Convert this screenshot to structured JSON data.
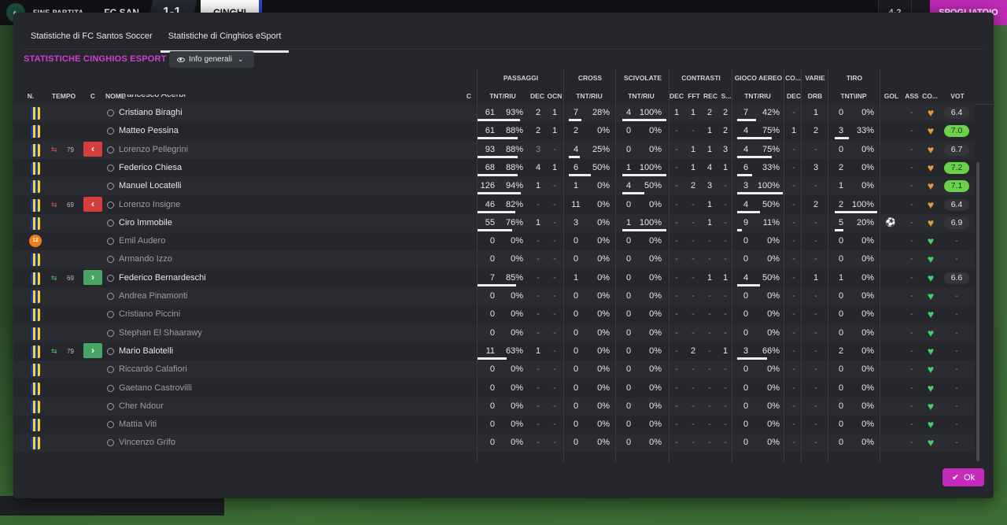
{
  "topbar": {
    "status": "FINE PARTITA",
    "home": "FC SAN",
    "score": "1-1",
    "away": "CINGHI",
    "count": "4-2",
    "action": "SPOGLIATOIO"
  },
  "tabs": [
    {
      "label": "Statistiche di FC Santos Soccer",
      "active": false
    },
    {
      "label": "Statistiche di Cinghios eSport",
      "active": true
    }
  ],
  "section_title": "STATISTICHE CINGHIOS ESPORT",
  "view_select": "Info generali",
  "groups": {
    "passaggi": "PASSAGGI",
    "cross": "CROSS",
    "scivolate": "SCIVOLATE",
    "contrasti": "CONTRASTI",
    "gioco_aereo": "GIOCO AEREO",
    "co": "CO...",
    "varie": "VARIE",
    "tiro": "TIRO"
  },
  "headers": {
    "n": "N.",
    "tempo": "TEMPO",
    "c": "C",
    "nome": "NOME",
    "c2": "C",
    "pass_tnt": "TNT/RIU",
    "pass_dec": "DEC",
    "pass_ocn": "OCN",
    "cross_tnt": "TNT/RIU",
    "sciv_tnt": "TNT/RIU",
    "con_dec": "DEC",
    "con_fft": "FFT",
    "con_rec": "REC",
    "con_s": "S...",
    "aer_tnt": "TNT/RIU",
    "co_dec": "DEC",
    "var_drb": "DRB",
    "tiro_tnt": "TNT\\INP",
    "gol": "GOL",
    "ass": "ASS",
    "co2": "CO...",
    "vot": "VOT"
  },
  "partial_row_name": "Francesco Acerbi",
  "players": [
    {
      "name": "Cristiano Biraghi",
      "dim": false,
      "sub": null,
      "min": "",
      "pass_n": "61",
      "pass_p": "93%",
      "pass_frac": 0.93,
      "dec": "2",
      "ocn": "1",
      "cross_n": "7",
      "cross_p": "28%",
      "cross_frac": 0.28,
      "sciv_n": "4",
      "sciv_p": "100%",
      "sciv_frac": 1.0,
      "cdec": "1",
      "cfft": "1",
      "crec": "2",
      "cs": "2",
      "aer_n": "7",
      "aer_p": "42%",
      "aer_frac": 0.42,
      "codec": "-",
      "drb": "1",
      "tiro_n": "0",
      "tiro_p": "0%",
      "tiro_frac": 0,
      "gol": "",
      "ass": "-",
      "heart": "orange",
      "vot": "6.4",
      "vot_style": "avg"
    },
    {
      "name": "Matteo Pessina",
      "dim": false,
      "sub": null,
      "min": "",
      "pass_n": "61",
      "pass_p": "88%",
      "pass_frac": 0.88,
      "dec": "2",
      "ocn": "1",
      "cross_n": "2",
      "cross_p": "0%",
      "cross_frac": 0,
      "sciv_n": "0",
      "sciv_p": "0%",
      "sciv_frac": 0,
      "cdec": "-",
      "cfft": "-",
      "crec": "1",
      "cs": "2",
      "aer_n": "4",
      "aer_p": "75%",
      "aer_frac": 0.75,
      "codec": "1",
      "drb": "2",
      "tiro_n": "3",
      "tiro_p": "33%",
      "tiro_frac": 0.33,
      "gol": "",
      "ass": "-",
      "heart": "orange",
      "vot": "7.0",
      "vot_style": "good"
    },
    {
      "name": "Lorenzo Pellegrini",
      "dim": true,
      "sub": "out",
      "min": "79",
      "pass_n": "93",
      "pass_p": "88%",
      "pass_frac": 0.88,
      "dec": "3",
      "ocn": "-",
      "cross_n": "4",
      "cross_p": "25%",
      "cross_frac": 0.25,
      "sciv_n": "0",
      "sciv_p": "0%",
      "sciv_frac": 0,
      "cdec": "-",
      "cfft": "1",
      "crec": "1",
      "cs": "3",
      "aer_n": "4",
      "aer_p": "75%",
      "aer_frac": 0.75,
      "codec": "-",
      "drb": "-",
      "tiro_n": "0",
      "tiro_p": "0%",
      "tiro_frac": 0,
      "gol": "",
      "ass": "-",
      "heart": "orange",
      "vot": "6.7",
      "vot_style": "avg"
    },
    {
      "name": "Federico Chiesa",
      "dim": false,
      "sub": null,
      "min": "",
      "pass_n": "68",
      "pass_p": "88%",
      "pass_frac": 0.88,
      "dec": "4",
      "ocn": "1",
      "cross_n": "6",
      "cross_p": "50%",
      "cross_frac": 0.5,
      "sciv_n": "1",
      "sciv_p": "100%",
      "sciv_frac": 1.0,
      "cdec": "-",
      "cfft": "1",
      "crec": "4",
      "cs": "1",
      "aer_n": "6",
      "aer_p": "33%",
      "aer_frac": 0.33,
      "codec": "-",
      "drb": "3",
      "tiro_n": "2",
      "tiro_p": "0%",
      "tiro_frac": 0,
      "gol": "",
      "ass": "-",
      "heart": "orange",
      "vot": "7.2",
      "vot_style": "good"
    },
    {
      "name": "Manuel Locatelli",
      "dim": false,
      "sub": null,
      "min": "",
      "pass_n": "126",
      "pass_p": "94%",
      "pass_frac": 0.94,
      "dec": "1",
      "ocn": "-",
      "cross_n": "1",
      "cross_p": "0%",
      "cross_frac": 0,
      "sciv_n": "4",
      "sciv_p": "50%",
      "sciv_frac": 0.5,
      "cdec": "-",
      "cfft": "2",
      "crec": "3",
      "cs": "-",
      "aer_n": "3",
      "aer_p": "100%",
      "aer_frac": 1.0,
      "codec": "-",
      "drb": "-",
      "tiro_n": "1",
      "tiro_p": "0%",
      "tiro_frac": 0,
      "gol": "",
      "ass": "-",
      "heart": "orange",
      "vot": "7.1",
      "vot_style": "good"
    },
    {
      "name": "Lorenzo Insigne",
      "dim": true,
      "sub": "out",
      "min": "69",
      "pass_n": "46",
      "pass_p": "82%",
      "pass_frac": 0.82,
      "dec": "-",
      "ocn": "-",
      "cross_n": "11",
      "cross_p": "0%",
      "cross_frac": 0,
      "sciv_n": "0",
      "sciv_p": "0%",
      "sciv_frac": 0,
      "cdec": "-",
      "cfft": "-",
      "crec": "1",
      "cs": "-",
      "aer_n": "4",
      "aer_p": "50%",
      "aer_frac": 0.5,
      "codec": "-",
      "drb": "2",
      "tiro_n": "2",
      "tiro_p": "100%",
      "tiro_frac": 1.0,
      "gol": "",
      "ass": "-",
      "heart": "orange",
      "vot": "6.4",
      "vot_style": "avg"
    },
    {
      "name": "Ciro Immobile",
      "dim": false,
      "sub": null,
      "min": "",
      "pass_n": "55",
      "pass_p": "76%",
      "pass_frac": 0.76,
      "dec": "1",
      "ocn": "-",
      "cross_n": "3",
      "cross_p": "0%",
      "cross_frac": 0,
      "sciv_n": "1",
      "sciv_p": "100%",
      "sciv_frac": 1.0,
      "cdec": "-",
      "cfft": "-",
      "crec": "1",
      "cs": "-",
      "aer_n": "9",
      "aer_p": "11%",
      "aer_frac": 0.11,
      "codec": "-",
      "drb": "-",
      "tiro_n": "5",
      "tiro_p": "20%",
      "tiro_frac": 0.2,
      "gol": "gear",
      "ass": "-",
      "heart": "orange",
      "vot": "6.9",
      "vot_style": "avg"
    },
    {
      "name": "Emil Audero",
      "dim": true,
      "gk": true,
      "gk_num": "12",
      "sub": null,
      "min": "",
      "pass_n": "0",
      "pass_p": "0%",
      "pass_frac": 0,
      "dec": "-",
      "ocn": "-",
      "cross_n": "0",
      "cross_p": "0%",
      "cross_frac": 0,
      "sciv_n": "0",
      "sciv_p": "0%",
      "sciv_frac": 0,
      "cdec": "-",
      "cfft": "-",
      "crec": "-",
      "cs": "-",
      "aer_n": "0",
      "aer_p": "0%",
      "aer_frac": 0,
      "codec": "-",
      "drb": "-",
      "tiro_n": "0",
      "tiro_p": "0%",
      "tiro_frac": 0,
      "gol": "",
      "ass": "-",
      "heart": "green",
      "vot": "-",
      "vot_style": "none"
    },
    {
      "name": "Armando Izzo",
      "dim": true,
      "sub": null,
      "min": "",
      "pass_n": "0",
      "pass_p": "0%",
      "pass_frac": 0,
      "dec": "-",
      "ocn": "-",
      "cross_n": "0",
      "cross_p": "0%",
      "cross_frac": 0,
      "sciv_n": "0",
      "sciv_p": "0%",
      "sciv_frac": 0,
      "cdec": "-",
      "cfft": "-",
      "crec": "-",
      "cs": "-",
      "aer_n": "0",
      "aer_p": "0%",
      "aer_frac": 0,
      "codec": "-",
      "drb": "-",
      "tiro_n": "0",
      "tiro_p": "0%",
      "tiro_frac": 0,
      "gol": "",
      "ass": "-",
      "heart": "green",
      "vot": "-",
      "vot_style": "none"
    },
    {
      "name": "Federico Bernardeschi",
      "dim": false,
      "sub": "in",
      "min": "69",
      "pass_n": "7",
      "pass_p": "85%",
      "pass_frac": 0.85,
      "dec": "-",
      "ocn": "-",
      "cross_n": "1",
      "cross_p": "0%",
      "cross_frac": 0,
      "sciv_n": "0",
      "sciv_p": "0%",
      "sciv_frac": 0,
      "cdec": "-",
      "cfft": "-",
      "crec": "1",
      "cs": "1",
      "aer_n": "4",
      "aer_p": "50%",
      "aer_frac": 0.5,
      "codec": "-",
      "drb": "1",
      "tiro_n": "1",
      "tiro_p": "0%",
      "tiro_frac": 0,
      "gol": "",
      "ass": "-",
      "heart": "green",
      "vot": "6.6",
      "vot_style": "avg"
    },
    {
      "name": "Andrea Pinamonti",
      "dim": true,
      "sub": null,
      "min": "",
      "pass_n": "0",
      "pass_p": "0%",
      "pass_frac": 0,
      "dec": "-",
      "ocn": "-",
      "cross_n": "0",
      "cross_p": "0%",
      "cross_frac": 0,
      "sciv_n": "0",
      "sciv_p": "0%",
      "sciv_frac": 0,
      "cdec": "-",
      "cfft": "-",
      "crec": "-",
      "cs": "-",
      "aer_n": "0",
      "aer_p": "0%",
      "aer_frac": 0,
      "codec": "-",
      "drb": "-",
      "tiro_n": "0",
      "tiro_p": "0%",
      "tiro_frac": 0,
      "gol": "",
      "ass": "-",
      "heart": "green",
      "vot": "-",
      "vot_style": "none"
    },
    {
      "name": "Cristiano Piccini",
      "dim": true,
      "sub": null,
      "min": "",
      "pass_n": "0",
      "pass_p": "0%",
      "pass_frac": 0,
      "dec": "-",
      "ocn": "-",
      "cross_n": "0",
      "cross_p": "0%",
      "cross_frac": 0,
      "sciv_n": "0",
      "sciv_p": "0%",
      "sciv_frac": 0,
      "cdec": "-",
      "cfft": "-",
      "crec": "-",
      "cs": "-",
      "aer_n": "0",
      "aer_p": "0%",
      "aer_frac": 0,
      "codec": "-",
      "drb": "-",
      "tiro_n": "0",
      "tiro_p": "0%",
      "tiro_frac": 0,
      "gol": "",
      "ass": "-",
      "heart": "green",
      "vot": "-",
      "vot_style": "none"
    },
    {
      "name": "Stephan El Shaarawy",
      "dim": true,
      "sub": null,
      "min": "",
      "pass_n": "0",
      "pass_p": "0%",
      "pass_frac": 0,
      "dec": "-",
      "ocn": "-",
      "cross_n": "0",
      "cross_p": "0%",
      "cross_frac": 0,
      "sciv_n": "0",
      "sciv_p": "0%",
      "sciv_frac": 0,
      "cdec": "-",
      "cfft": "-",
      "crec": "-",
      "cs": "-",
      "aer_n": "0",
      "aer_p": "0%",
      "aer_frac": 0,
      "codec": "-",
      "drb": "-",
      "tiro_n": "0",
      "tiro_p": "0%",
      "tiro_frac": 0,
      "gol": "",
      "ass": "-",
      "heart": "green",
      "vot": "-",
      "vot_style": "none"
    },
    {
      "name": "Mario Balotelli",
      "dim": false,
      "sub": "in",
      "min": "79",
      "pass_n": "11",
      "pass_p": "63%",
      "pass_frac": 0.63,
      "dec": "1",
      "ocn": "-",
      "cross_n": "0",
      "cross_p": "0%",
      "cross_frac": 0,
      "sciv_n": "0",
      "sciv_p": "0%",
      "sciv_frac": 0,
      "cdec": "-",
      "cfft": "2",
      "crec": "-",
      "cs": "1",
      "aer_n": "3",
      "aer_p": "66%",
      "aer_frac": 0.66,
      "codec": "-",
      "drb": "-",
      "tiro_n": "2",
      "tiro_p": "0%",
      "tiro_frac": 0,
      "gol": "",
      "ass": "-",
      "heart": "green",
      "vot": "-",
      "vot_style": "none"
    },
    {
      "name": "Riccardo Calafiori",
      "dim": true,
      "sub": null,
      "min": "",
      "pass_n": "0",
      "pass_p": "0%",
      "pass_frac": 0,
      "dec": "-",
      "ocn": "-",
      "cross_n": "0",
      "cross_p": "0%",
      "cross_frac": 0,
      "sciv_n": "0",
      "sciv_p": "0%",
      "sciv_frac": 0,
      "cdec": "-",
      "cfft": "-",
      "crec": "-",
      "cs": "-",
      "aer_n": "0",
      "aer_p": "0%",
      "aer_frac": 0,
      "codec": "-",
      "drb": "-",
      "tiro_n": "0",
      "tiro_p": "0%",
      "tiro_frac": 0,
      "gol": "",
      "ass": "-",
      "heart": "green",
      "vot": "-",
      "vot_style": "none"
    },
    {
      "name": "Gaetano Castrovilli",
      "dim": true,
      "sub": null,
      "min": "",
      "pass_n": "0",
      "pass_p": "0%",
      "pass_frac": 0,
      "dec": "-",
      "ocn": "-",
      "cross_n": "0",
      "cross_p": "0%",
      "cross_frac": 0,
      "sciv_n": "0",
      "sciv_p": "0%",
      "sciv_frac": 0,
      "cdec": "-",
      "cfft": "-",
      "crec": "-",
      "cs": "-",
      "aer_n": "0",
      "aer_p": "0%",
      "aer_frac": 0,
      "codec": "-",
      "drb": "-",
      "tiro_n": "0",
      "tiro_p": "0%",
      "tiro_frac": 0,
      "gol": "",
      "ass": "-",
      "heart": "green",
      "vot": "-",
      "vot_style": "none"
    },
    {
      "name": "Cher Ndour",
      "dim": true,
      "sub": null,
      "min": "",
      "pass_n": "0",
      "pass_p": "0%",
      "pass_frac": 0,
      "dec": "-",
      "ocn": "-",
      "cross_n": "0",
      "cross_p": "0%",
      "cross_frac": 0,
      "sciv_n": "0",
      "sciv_p": "0%",
      "sciv_frac": 0,
      "cdec": "-",
      "cfft": "-",
      "crec": "-",
      "cs": "-",
      "aer_n": "0",
      "aer_p": "0%",
      "aer_frac": 0,
      "codec": "-",
      "drb": "-",
      "tiro_n": "0",
      "tiro_p": "0%",
      "tiro_frac": 0,
      "gol": "",
      "ass": "-",
      "heart": "green",
      "vot": "-",
      "vot_style": "none"
    },
    {
      "name": "Mattia Viti",
      "dim": true,
      "sub": null,
      "min": "",
      "pass_n": "0",
      "pass_p": "0%",
      "pass_frac": 0,
      "dec": "-",
      "ocn": "-",
      "cross_n": "0",
      "cross_p": "0%",
      "cross_frac": 0,
      "sciv_n": "0",
      "sciv_p": "0%",
      "sciv_frac": 0,
      "cdec": "-",
      "cfft": "-",
      "crec": "-",
      "cs": "-",
      "aer_n": "0",
      "aer_p": "0%",
      "aer_frac": 0,
      "codec": "-",
      "drb": "-",
      "tiro_n": "0",
      "tiro_p": "0%",
      "tiro_frac": 0,
      "gol": "",
      "ass": "-",
      "heart": "green",
      "vot": "-",
      "vot_style": "none"
    },
    {
      "name": "Vincenzo Grifo",
      "dim": true,
      "sub": null,
      "min": "",
      "pass_n": "0",
      "pass_p": "0%",
      "pass_frac": 0,
      "dec": "-",
      "ocn": "-",
      "cross_n": "0",
      "cross_p": "0%",
      "cross_frac": 0,
      "sciv_n": "0",
      "sciv_p": "0%",
      "sciv_frac": 0,
      "cdec": "-",
      "cfft": "-",
      "crec": "-",
      "cs": "-",
      "aer_n": "0",
      "aer_p": "0%",
      "aer_frac": 0,
      "codec": "-",
      "drb": "-",
      "tiro_n": "0",
      "tiro_p": "0%",
      "tiro_frac": 0,
      "gol": "",
      "ass": "-",
      "heart": "green",
      "vot": "-",
      "vot_style": "none"
    }
  ],
  "ok_label": "Ok",
  "colors": {
    "accent": "#c52bbb",
    "section_title": "#d23fd0",
    "sub_out": "#d63d3d",
    "sub_in": "#4aa565",
    "vote_good": "#6bd14a",
    "heart_orange": "#e69a3c",
    "heart_green": "#3fd46a"
  }
}
